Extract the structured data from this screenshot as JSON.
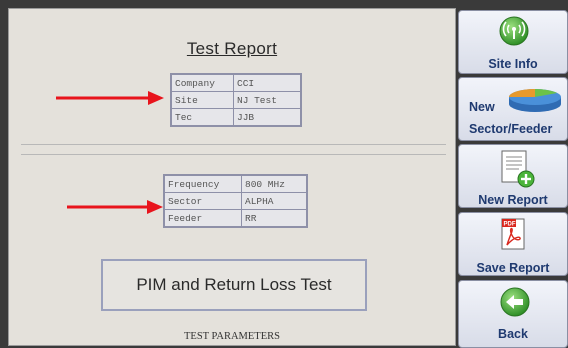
{
  "report": {
    "title": "Test Report",
    "site_table": [
      {
        "label": "Company",
        "value": "CCI"
      },
      {
        "label": "Site",
        "value": "NJ Test"
      },
      {
        "label": "Tec",
        "value": "JJB"
      }
    ],
    "sector_table": [
      {
        "label": "Frequency",
        "value": "800 MHz"
      },
      {
        "label": "Sector",
        "value": "ALPHA"
      },
      {
        "label": "Feeder",
        "value": "RR"
      }
    ],
    "test_title": "PIM and Return Loss Test",
    "parameters_heading": "TEST PARAMETERS"
  },
  "sidebar": {
    "buttons": [
      {
        "label": "Site Info",
        "icon": "antenna-icon"
      },
      {
        "label_line1": "New",
        "label_line2": "Sector/Feeder",
        "icon": "pie-chart-icon"
      },
      {
        "label": "New Report",
        "icon": "new-document-icon"
      },
      {
        "label": "Save Report",
        "icon": "pdf-icon"
      },
      {
        "label": "Back",
        "icon": "back-arrow-icon"
      }
    ]
  },
  "colors": {
    "annotation_arrow": "#e8141c",
    "button_text": "#1f3a70",
    "green_icon": "#4bb43a"
  }
}
